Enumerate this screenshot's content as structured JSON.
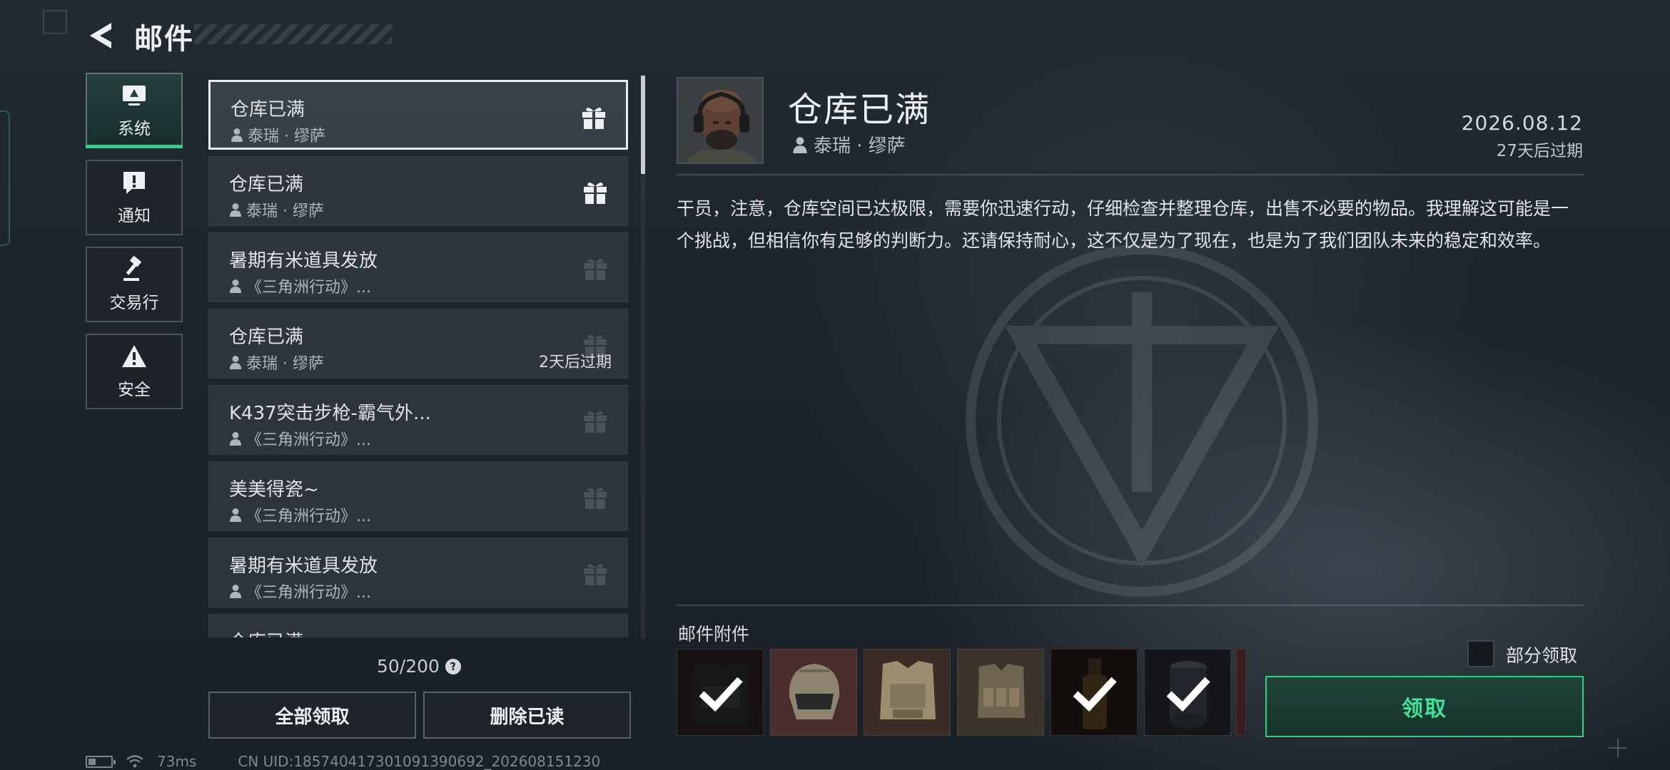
{
  "header": {
    "title": "邮件"
  },
  "categories": [
    {
      "label": "系统",
      "icon": "monitor-icon",
      "active": true
    },
    {
      "label": "通知",
      "icon": "alert-message-icon",
      "active": false
    },
    {
      "label": "交易行",
      "icon": "gavel-icon",
      "active": false
    },
    {
      "label": "安全",
      "icon": "warning-triangle-icon",
      "active": false
    }
  ],
  "mails": [
    {
      "title": "仓库已满",
      "sender": "泰瑞 · 缪萨",
      "gift": "available",
      "selected": true,
      "expire": ""
    },
    {
      "title": "仓库已满",
      "sender": "泰瑞 · 缪萨",
      "gift": "available",
      "selected": false,
      "expire": ""
    },
    {
      "title": "暑期有米道具发放",
      "sender": "《三角洲行动》...",
      "gift": "claimed",
      "selected": false,
      "expire": ""
    },
    {
      "title": "仓库已满",
      "sender": "泰瑞 · 缪萨",
      "gift": "claimed",
      "selected": false,
      "expire": "2天后过期"
    },
    {
      "title": "K437突击步枪-霸气外...",
      "sender": "《三角洲行动》...",
      "gift": "claimed",
      "selected": false,
      "expire": ""
    },
    {
      "title": "美美得瓷~",
      "sender": "《三角洲行动》...",
      "gift": "claimed",
      "selected": false,
      "expire": ""
    },
    {
      "title": "暑期有米道具发放",
      "sender": "《三角洲行动》...",
      "gift": "claimed",
      "selected": false,
      "expire": ""
    },
    {
      "title": "仓库已满",
      "sender": "",
      "gift": "claimed",
      "selected": false,
      "expire": ""
    }
  ],
  "list_footer": {
    "count": "50/200",
    "help": "?"
  },
  "buttons": {
    "claim_all": "全部领取",
    "delete_read": "删除已读",
    "claim": "领取"
  },
  "status": {
    "ping": "73ms",
    "uid": "CN UID:185740417301091390692_202608151230"
  },
  "detail": {
    "title": "仓库已满",
    "sender": "泰瑞 · 缪萨",
    "date": "2026.08.12",
    "expire": "27天后过期",
    "body": "干员，注意，仓库空间已达极限，需要你迅速行动，仔细检查并整理仓库，出售不必要的物品。我理解这可能是一个挑战，但相信你有足够的判断力。还请保持耐心，这不仅是为了现在，也是为了我们团队未来的稳定和效率。"
  },
  "attachments": {
    "label": "邮件附件",
    "partial_label": "部分领取",
    "items": [
      {
        "name": "body-armor-dark",
        "claimed": true
      },
      {
        "name": "tactical-helmet",
        "claimed": false
      },
      {
        "name": "ballistic-vest",
        "claimed": false
      },
      {
        "name": "chest-rig",
        "claimed": false
      },
      {
        "name": "bottle",
        "claimed": true
      },
      {
        "name": "canister",
        "claimed": true
      }
    ]
  },
  "colors": {
    "accent": "#2fd08a",
    "claim_text": "#3fe39a",
    "selected_border": "#e8ecef"
  }
}
